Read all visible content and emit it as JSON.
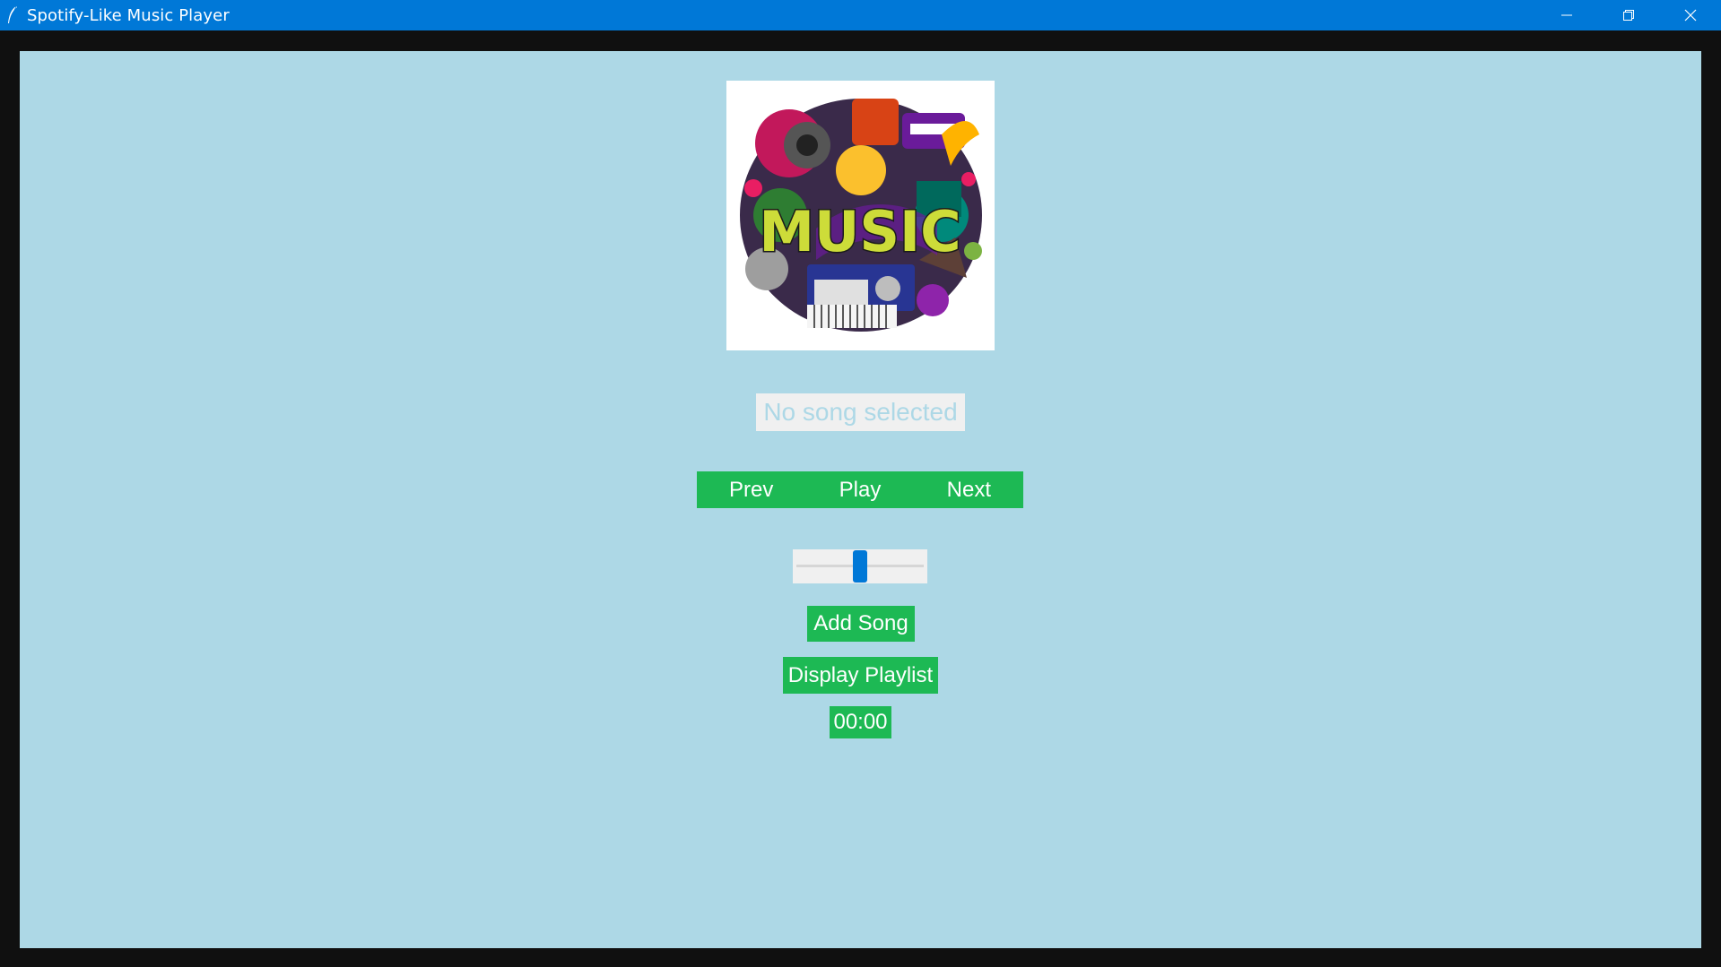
{
  "window": {
    "title": "Spotify-Like Music Player",
    "controls": {
      "minimize_icon": "minimize-icon",
      "restore_icon": "restore-icon",
      "close_icon": "close-icon"
    }
  },
  "player": {
    "album_art_text": "MUSIC",
    "song_label": "No song selected",
    "prev_label": "Prev",
    "play_label": "Play",
    "next_label": "Next",
    "volume_level": 0.5,
    "add_song_label": "Add Song",
    "display_playlist_label": "Display Playlist",
    "time_label": "00:00"
  },
  "colors": {
    "titlebar": "#0078d7",
    "background": "#add8e6",
    "accent_green": "#1db954",
    "slider_thumb": "#0078d7"
  }
}
